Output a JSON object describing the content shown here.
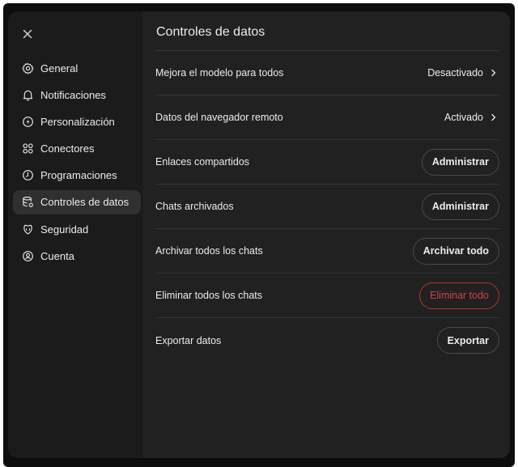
{
  "sidebar": {
    "close_label": "×",
    "items": [
      {
        "label": "General",
        "icon": "gear-icon"
      },
      {
        "label": "Notificaciones",
        "icon": "bell-icon"
      },
      {
        "label": "Personalización",
        "icon": "personalization-icon"
      },
      {
        "label": "Conectores",
        "icon": "connectors-icon"
      },
      {
        "label": "Programaciones",
        "icon": "clock-icon"
      },
      {
        "label": "Controles de datos",
        "icon": "database-icon",
        "active": true
      },
      {
        "label": "Seguridad",
        "icon": "shield-icon"
      },
      {
        "label": "Cuenta",
        "icon": "account-icon"
      }
    ]
  },
  "main": {
    "title": "Controles de datos",
    "rows": [
      {
        "label": "Mejora el modelo para todos",
        "action": "Desactivado"
      },
      {
        "label": "Datos del navegador remoto",
        "action": "Activado"
      },
      {
        "label": "Enlaces compartidos",
        "action": "Administrar"
      },
      {
        "label": "Chats archivados",
        "action": "Administrar"
      },
      {
        "label": "Archivar todos los chats",
        "action": "Archivar todo"
      },
      {
        "label": "Eliminar todos los chats",
        "action": "Eliminar todo"
      },
      {
        "label": "Exportar datos",
        "action": "Exportar"
      }
    ]
  },
  "colors": {
    "background": "#212121",
    "sidebar": "#1b1b1b",
    "active_item": "#303030",
    "text": "#ececec",
    "danger": "#d1413f"
  }
}
